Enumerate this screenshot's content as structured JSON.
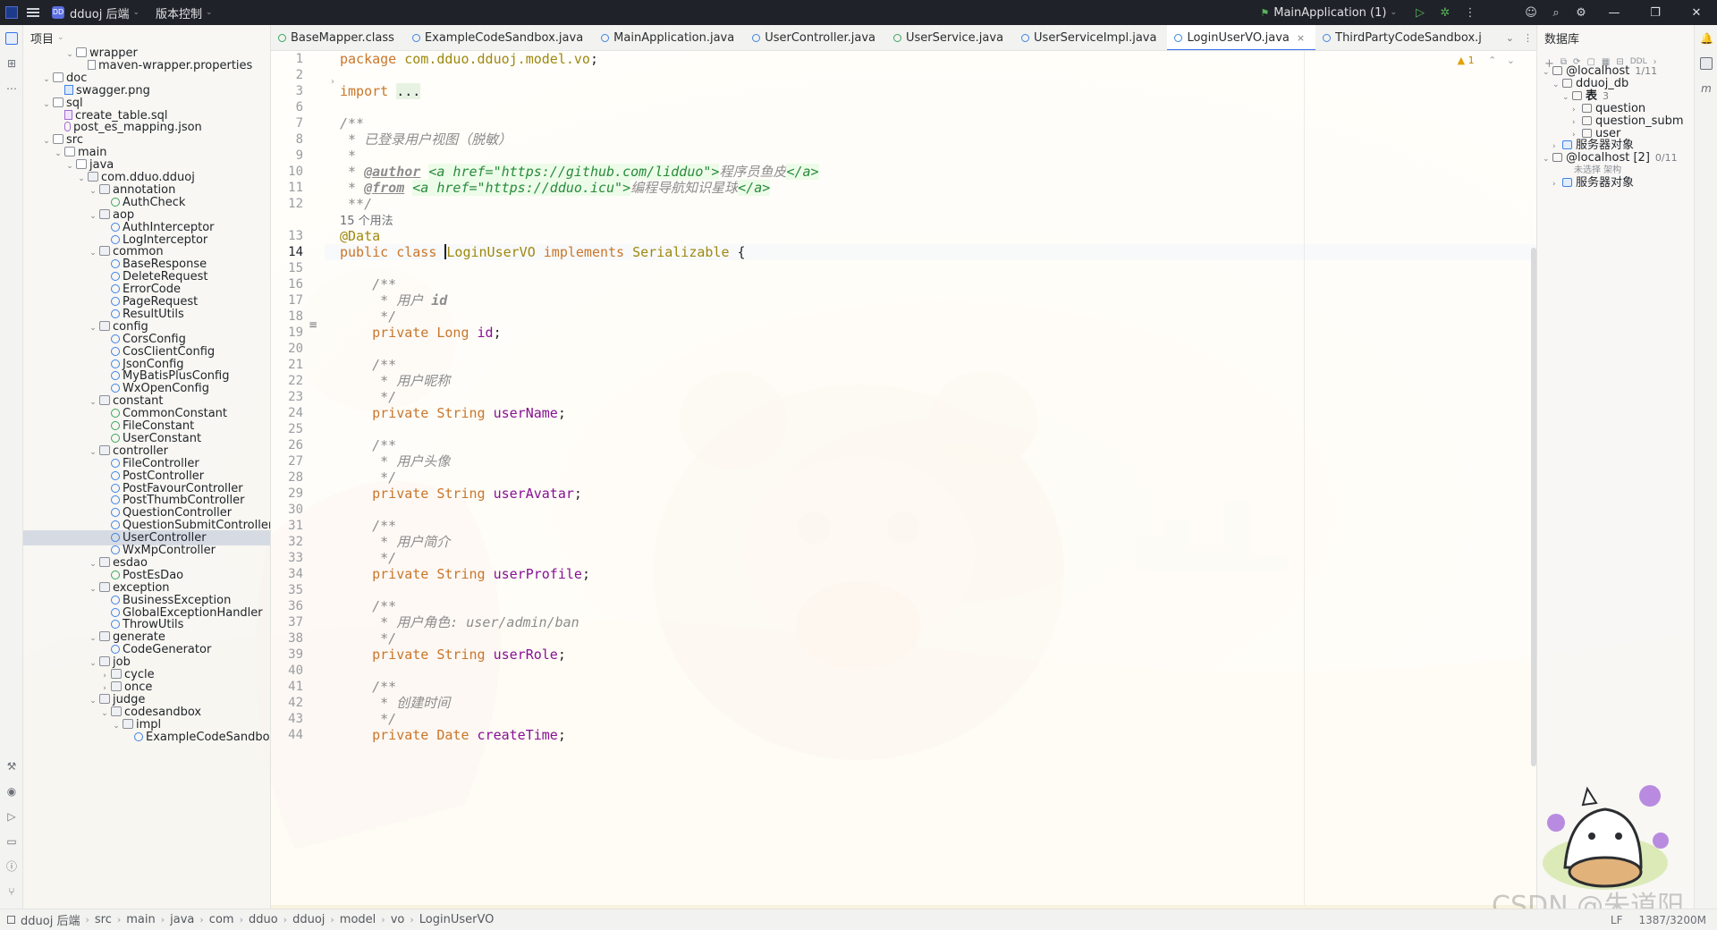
{
  "titlebar": {
    "project_name": "dduoj 后端",
    "vcs_label": "版本控制",
    "run_config": "MainApplication (1)",
    "project_badge": "DD"
  },
  "project_panel": {
    "title": "项目",
    "tree": [
      {
        "label": "wrapper",
        "kind": "folder",
        "indent": 3,
        "open": true
      },
      {
        "label": "maven-wrapper.properties",
        "kind": "file",
        "indent": 4
      },
      {
        "label": "doc",
        "kind": "folder",
        "indent": 1,
        "open": true
      },
      {
        "label": "swagger.png",
        "kind": "img",
        "indent": 2
      },
      {
        "label": "sql",
        "kind": "folder",
        "indent": 1,
        "open": true
      },
      {
        "label": "create_table.sql",
        "kind": "sql",
        "indent": 2
      },
      {
        "label": "post_es_mapping.json",
        "kind": "json",
        "indent": 2
      },
      {
        "label": "src",
        "kind": "folder",
        "indent": 1,
        "open": true
      },
      {
        "label": "main",
        "kind": "folder",
        "indent": 2,
        "open": true
      },
      {
        "label": "java",
        "kind": "folder",
        "indent": 3,
        "open": true
      },
      {
        "label": "com.dduo.dduoj",
        "kind": "pkg",
        "indent": 4,
        "open": true
      },
      {
        "label": "annotation",
        "kind": "pkg",
        "indent": 5,
        "open": true
      },
      {
        "label": "AuthCheck",
        "kind": "iface",
        "indent": 6
      },
      {
        "label": "aop",
        "kind": "pkg",
        "indent": 5,
        "open": true
      },
      {
        "label": "AuthInterceptor",
        "kind": "class",
        "indent": 6
      },
      {
        "label": "LogInterceptor",
        "kind": "class",
        "indent": 6
      },
      {
        "label": "common",
        "kind": "pkg",
        "indent": 5,
        "open": true
      },
      {
        "label": "BaseResponse",
        "kind": "class",
        "indent": 6
      },
      {
        "label": "DeleteRequest",
        "kind": "class",
        "indent": 6
      },
      {
        "label": "ErrorCode",
        "kind": "class",
        "indent": 6
      },
      {
        "label": "PageRequest",
        "kind": "class",
        "indent": 6
      },
      {
        "label": "ResultUtils",
        "kind": "class",
        "indent": 6
      },
      {
        "label": "config",
        "kind": "pkg",
        "indent": 5,
        "open": true
      },
      {
        "label": "CorsConfig",
        "kind": "class",
        "indent": 6
      },
      {
        "label": "CosClientConfig",
        "kind": "class",
        "indent": 6
      },
      {
        "label": "JsonConfig",
        "kind": "class",
        "indent": 6
      },
      {
        "label": "MyBatisPlusConfig",
        "kind": "class",
        "indent": 6
      },
      {
        "label": "WxOpenConfig",
        "kind": "class",
        "indent": 6
      },
      {
        "label": "constant",
        "kind": "pkg",
        "indent": 5,
        "open": true
      },
      {
        "label": "CommonConstant",
        "kind": "iface",
        "indent": 6
      },
      {
        "label": "FileConstant",
        "kind": "iface",
        "indent": 6
      },
      {
        "label": "UserConstant",
        "kind": "iface",
        "indent": 6
      },
      {
        "label": "controller",
        "kind": "pkg",
        "indent": 5,
        "open": true
      },
      {
        "label": "FileController",
        "kind": "class",
        "indent": 6
      },
      {
        "label": "PostController",
        "kind": "class",
        "indent": 6
      },
      {
        "label": "PostFavourController",
        "kind": "class",
        "indent": 6
      },
      {
        "label": "PostThumbController",
        "kind": "class",
        "indent": 6
      },
      {
        "label": "QuestionController",
        "kind": "class",
        "indent": 6
      },
      {
        "label": "QuestionSubmitController",
        "kind": "class",
        "indent": 6
      },
      {
        "label": "UserController",
        "kind": "class",
        "indent": 6,
        "selected": true
      },
      {
        "label": "WxMpController",
        "kind": "class",
        "indent": 6
      },
      {
        "label": "esdao",
        "kind": "pkg",
        "indent": 5,
        "open": true
      },
      {
        "label": "PostEsDao",
        "kind": "iface",
        "indent": 6
      },
      {
        "label": "exception",
        "kind": "pkg",
        "indent": 5,
        "open": true
      },
      {
        "label": "BusinessException",
        "kind": "class",
        "indent": 6
      },
      {
        "label": "GlobalExceptionHandler",
        "kind": "class",
        "indent": 6
      },
      {
        "label": "ThrowUtils",
        "kind": "class",
        "indent": 6
      },
      {
        "label": "generate",
        "kind": "pkg",
        "indent": 5,
        "open": true
      },
      {
        "label": "CodeGenerator",
        "kind": "class",
        "indent": 6
      },
      {
        "label": "job",
        "kind": "pkg",
        "indent": 5,
        "open": true
      },
      {
        "label": "cycle",
        "kind": "pkg",
        "indent": 6,
        "open": false
      },
      {
        "label": "once",
        "kind": "pkg",
        "indent": 6,
        "open": false
      },
      {
        "label": "judge",
        "kind": "pkg",
        "indent": 5,
        "open": true
      },
      {
        "label": "codesandbox",
        "kind": "pkg",
        "indent": 6,
        "open": true
      },
      {
        "label": "impl",
        "kind": "pkg",
        "indent": 7,
        "open": true
      },
      {
        "label": "ExampleCodeSandbox",
        "kind": "class",
        "indent": 8
      }
    ]
  },
  "tabs": [
    {
      "label": "BaseMapper.class",
      "icon": "green"
    },
    {
      "label": "ExampleCodeSandbox.java",
      "icon": "blue"
    },
    {
      "label": "MainApplication.java",
      "icon": "blue"
    },
    {
      "label": "UserController.java",
      "icon": "blue"
    },
    {
      "label": "UserService.java",
      "icon": "green"
    },
    {
      "label": "UserServiceImpl.java",
      "icon": "blue"
    },
    {
      "label": "LoginUserVO.java",
      "icon": "blue",
      "active": true
    },
    {
      "label": "ThirdPartyCodeSandbox.j",
      "icon": "blue"
    }
  ],
  "editor": {
    "warning_count": "1",
    "lines": [
      {
        "n": "1",
        "html": "<span class='kw'>package</span> <span class='ann'>com.dduo.dduoj.model.vo</span>;"
      },
      {
        "n": "2",
        "html": ""
      },
      {
        "n": "3",
        "html": "<span class='kw'>import</span> <span class='fold-hl'>...</span>"
      },
      {
        "n": "6",
        "html": ""
      },
      {
        "n": "7",
        "html": "<span class='cm'>/**</span>"
      },
      {
        "n": "8",
        "html": "<span class='cm'> * 已登录用户视图（脱敏）</span>"
      },
      {
        "n": "9",
        "html": "<span class='cm'> *</span>"
      },
      {
        "n": "10",
        "html": "<span class='cm'> * </span><span class='doc-tag'>@author</span> <span class='tag-hl'>&lt;a href=\"https://github.com/lidduo\"&gt;</span><span class='cm'>程序员鱼皮</span><span class='tag-hl'>&lt;/a&gt;</span>"
      },
      {
        "n": "11",
        "html": "<span class='cm'> * </span><span class='doc-tag'>@from</span> <span class='tag-hl'>&lt;a href=\"https://dduo.icu\"&gt;</span><span class='cm'>编程导航知识星球</span><span class='tag-hl'>&lt;/a&gt;</span>"
      },
      {
        "n": "12",
        "html": "<span class='cm'> **/</span>"
      },
      {
        "n": "",
        "html": "<span class='usage-hint'>15 个用法</span>"
      },
      {
        "n": "13",
        "html": "<span class='ann'>@Data</span>"
      },
      {
        "n": "14",
        "html": "<span class='kw'>public class </span><span class='caret'></span><span class='ann'>LoginUserVO</span> <span class='kw'>implements</span> <span class='ann'>Serializable</span> {",
        "current": true
      },
      {
        "n": "15",
        "html": ""
      },
      {
        "n": "16",
        "html": "    <span class='cm'>/**</span>"
      },
      {
        "n": "17",
        "html": "<span class='cm'>     * 用户 </span><span class='cm' style='font-weight:bold'>id</span>"
      },
      {
        "n": "18",
        "html": "<span class='cm'>     */</span>"
      },
      {
        "n": "19",
        "html": "    <span class='kw'>private</span> <span class='kw'>Long</span> <span class='fld'>id</span>;"
      },
      {
        "n": "20",
        "html": ""
      },
      {
        "n": "21",
        "html": "    <span class='cm'>/**</span>"
      },
      {
        "n": "22",
        "html": "<span class='cm'>     * 用户昵称</span>"
      },
      {
        "n": "23",
        "html": "<span class='cm'>     */</span>"
      },
      {
        "n": "24",
        "html": "    <span class='kw'>private</span> <span class='kw'>String</span> <span class='fld'>userName</span>;"
      },
      {
        "n": "25",
        "html": ""
      },
      {
        "n": "26",
        "html": "    <span class='cm'>/**</span>"
      },
      {
        "n": "27",
        "html": "<span class='cm'>     * 用户头像</span>"
      },
      {
        "n": "28",
        "html": "<span class='cm'>     */</span>"
      },
      {
        "n": "29",
        "html": "    <span class='kw'>private</span> <span class='kw'>String</span> <span class='fld'>userAvatar</span>;"
      },
      {
        "n": "30",
        "html": ""
      },
      {
        "n": "31",
        "html": "    <span class='cm'>/**</span>"
      },
      {
        "n": "32",
        "html": "<span class='cm'>     * 用户简介</span>"
      },
      {
        "n": "33",
        "html": "<span class='cm'>     */</span>"
      },
      {
        "n": "34",
        "html": "    <span class='kw'>private</span> <span class='kw'>String</span> <span class='fld'>userProfile</span>;"
      },
      {
        "n": "35",
        "html": ""
      },
      {
        "n": "36",
        "html": "    <span class='cm'>/**</span>"
      },
      {
        "n": "37",
        "html": "<span class='cm'>     * 用户角色: user/admin/ban</span>"
      },
      {
        "n": "38",
        "html": "<span class='cm'>     */</span>"
      },
      {
        "n": "39",
        "html": "    <span class='kw'>private</span> <span class='kw'>String</span> <span class='fld'>userRole</span>;"
      },
      {
        "n": "40",
        "html": ""
      },
      {
        "n": "41",
        "html": "    <span class='cm'>/**</span>"
      },
      {
        "n": "42",
        "html": "<span class='cm'>     * 创建时间</span>"
      },
      {
        "n": "43",
        "html": "<span class='cm'>     */</span>"
      },
      {
        "n": "44",
        "html": "    <span class='kw'>private</span> <span class='kw'>Date</span> <span class='fld'>createTime</span>;"
      }
    ]
  },
  "db_panel": {
    "title": "数据库",
    "toolbar_ddl": "DDL",
    "rows": [
      {
        "label": "@localhost",
        "sub": "1/11",
        "indent": 0,
        "chev": "⌄"
      },
      {
        "label": "dduoj_db",
        "indent": 1,
        "chev": "⌄"
      },
      {
        "label": "表",
        "sub": "3",
        "indent": 2,
        "chev": "⌄",
        "bold": true
      },
      {
        "label": "question",
        "indent": 3,
        "chev": "›"
      },
      {
        "label": "question_subm",
        "indent": 3,
        "chev": "›"
      },
      {
        "label": "user",
        "indent": 3,
        "chev": "›"
      },
      {
        "label": "服务器对象",
        "indent": 1,
        "chev": "›",
        "blue": true
      },
      {
        "label": "@localhost [2]",
        "sub": "0/11",
        "indent": 0,
        "chev": "⌄"
      },
      {
        "label": "未选择 架构",
        "indent": 1,
        "small": true
      },
      {
        "label": "服务器对象",
        "indent": 1,
        "chev": "›",
        "blue": true
      }
    ]
  },
  "statusbar": {
    "crumbs": [
      "dduoj 后端",
      "src",
      "main",
      "java",
      "com",
      "dduo",
      "dduoj",
      "model",
      "vo",
      "LoginUserVO"
    ],
    "line_sep": "LF",
    "memory": "1387/3200M"
  },
  "watermark": "CSDN @朱道阳",
  "colors": {
    "accent": "#3574f0",
    "keyword": "#c9762a",
    "field": "#871094",
    "annotation": "#9e880d"
  }
}
